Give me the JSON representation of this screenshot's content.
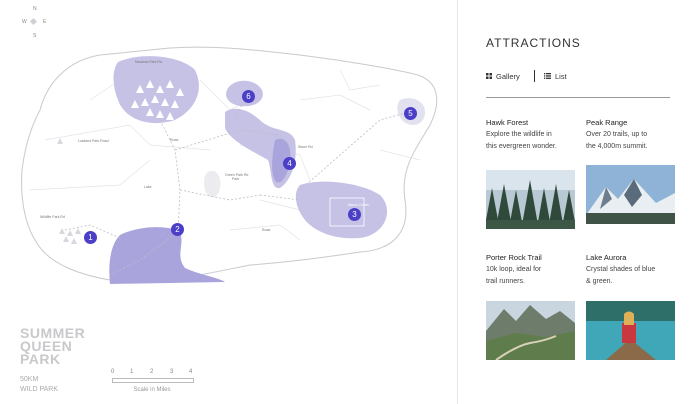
{
  "map": {
    "compass": {
      "n": "N",
      "s": "S",
      "w": "W",
      "e": "E"
    },
    "park_name_line1": "SUMMER",
    "park_name_line2": "QUEEN",
    "park_name_line3": "PARK",
    "park_sub1": "50KM",
    "park_sub2": "WILD PARK",
    "scale": {
      "ticks": [
        "0",
        "1",
        "2",
        "3",
        "4"
      ],
      "caption": "Scale in Miles"
    },
    "markers": [
      "1",
      "2",
      "3",
      "4",
      "5",
      "6"
    ],
    "labels": {
      "top": "Meadow Park Rd",
      "left": "Lowland Park Road",
      "lake": "Lake",
      "greenpark": "Green Park Rd",
      "road2": "Road",
      "road3": "Road",
      "stone": "Stone Rd",
      "manor": "Manor Center",
      "west": "Wildlife Park Rd",
      "parkpond": "Park"
    }
  },
  "panel": {
    "title": "ATTRACTIONS",
    "tabs": {
      "gallery": "Gallery",
      "list": "List"
    },
    "cards": [
      {
        "title": "Hawk Forest",
        "desc1": "Explore the wildlife in",
        "desc2": "this evergreen wonder."
      },
      {
        "title": "Peak Range",
        "desc1": "Over 20 trails, up to",
        "desc2": "the 4,000m summit."
      },
      {
        "title": "Porter Rock Trail",
        "desc1": "10k loop, ideal for",
        "desc2": "trail runners."
      },
      {
        "title": "Lake Aurora",
        "desc1": "Crystal shades of blue",
        "desc2": "& green."
      }
    ]
  },
  "colors": {
    "accent": "#4b3fc8",
    "region": "#c5c2e6",
    "region_dark": "#a9a4dc"
  }
}
